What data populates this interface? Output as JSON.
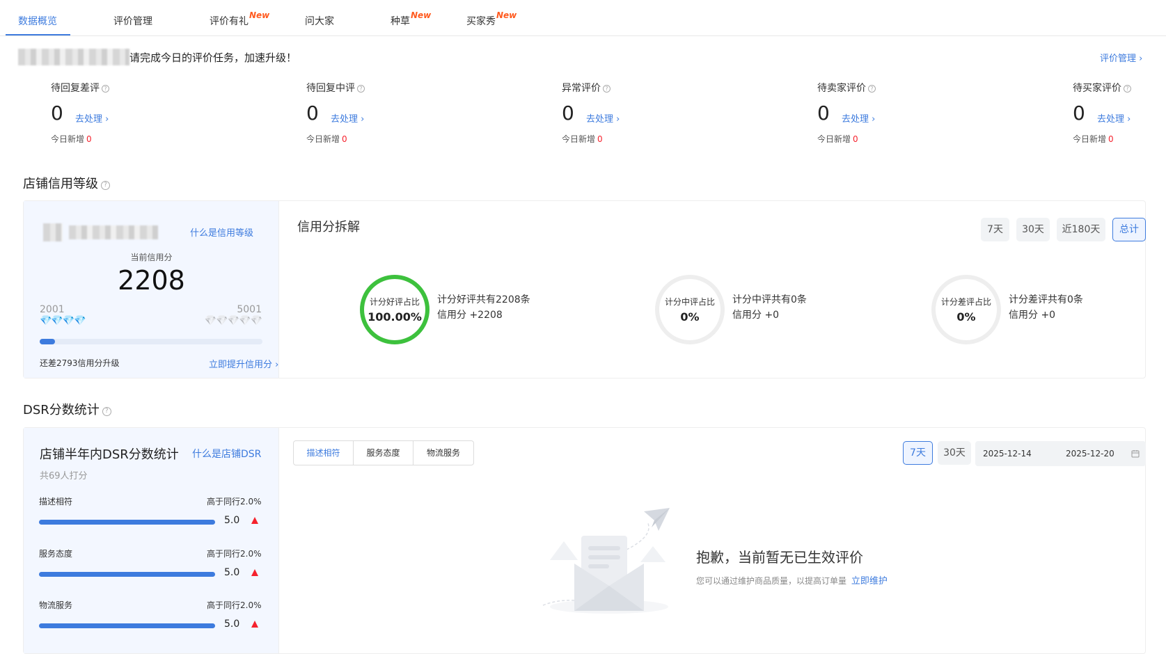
{
  "tabs": [
    {
      "label": "数据概览",
      "new": ""
    },
    {
      "label": "评价管理",
      "new": ""
    },
    {
      "label": "评价有礼",
      "new": "New"
    },
    {
      "label": "问大家",
      "new": ""
    },
    {
      "label": "种草",
      "new": "New"
    },
    {
      "label": "买家秀",
      "new": "New"
    }
  ],
  "notice": {
    "text": "请完成今日的评价任务，加速升级！",
    "link": "评价管理 ›"
  },
  "stats": [
    {
      "label": "待回复差评",
      "value": "0",
      "action": "去处理 ›",
      "today_label": "今日新增",
      "today_value": "0"
    },
    {
      "label": "待回复中评",
      "value": "0",
      "action": "去处理 ›",
      "today_label": "今日新增",
      "today_value": "0"
    },
    {
      "label": "异常评价",
      "value": "0",
      "action": "去处理 ›",
      "today_label": "今日新增",
      "today_value": "0"
    },
    {
      "label": "待卖家评价",
      "value": "0",
      "action": "去处理 ›",
      "today_label": "今日新增",
      "today_value": "0"
    },
    {
      "label": "待买家评价",
      "value": "0",
      "action": "去处理 ›",
      "today_label": "今日新增",
      "today_value": "0"
    }
  ],
  "credit": {
    "section_title": "店铺信用等级",
    "what_link": "什么是信用等级",
    "current_label": "当前信用分",
    "current_value": "2208",
    "range_min": "2001",
    "range_max": "5001",
    "progress": 0.07,
    "gap_text": "还差2793信用分升级",
    "improve_link": "立即提升信用分 ›",
    "breakdown_title": "信用分拆解",
    "periods": [
      "7天",
      "30天",
      "近180天",
      "总计"
    ],
    "active_period": "总计",
    "rings": [
      {
        "label": "计分好评占比",
        "value": "100.00%",
        "ratio": 1.0,
        "color": "#3dc13d",
        "line1": "计分好评共有2208条",
        "line2": "信用分 +2208"
      },
      {
        "label": "计分中评占比",
        "value": "0%",
        "ratio": 0,
        "color": "#3dc13d",
        "line1": "计分中评共有0条",
        "line2": "信用分 +0"
      },
      {
        "label": "计分差评占比",
        "value": "0%",
        "ratio": 0,
        "color": "#3dc13d",
        "line1": "计分差评共有0条",
        "line2": "信用分 +0"
      }
    ]
  },
  "dsr": {
    "section_title": "DSR分数统计",
    "panel_title": "店铺半年内DSR分数统计",
    "what_link": "什么是店铺DSR",
    "raters": "共69人打分",
    "rows": [
      {
        "label": "描述相符",
        "compare": "高于同行2.0%",
        "score": "5.0",
        "ratio": 1.0
      },
      {
        "label": "服务态度",
        "compare": "高于同行2.0%",
        "score": "5.0",
        "ratio": 1.0
      },
      {
        "label": "物流服务",
        "compare": "高于同行2.0%",
        "score": "5.0",
        "ratio": 1.0
      }
    ],
    "segments": [
      "描述相符",
      "服务态度",
      "物流服务"
    ],
    "active_segment": "描述相符",
    "periods": [
      "7天",
      "30天"
    ],
    "active_period": "7天",
    "date_start": "2025-12-14",
    "date_end": "2025-12-20",
    "empty_title": "抱歉，当前暂无已生效评价",
    "empty_desc": "您可以通过维护商品质量，以提高订单量",
    "empty_link": "立即维护"
  }
}
